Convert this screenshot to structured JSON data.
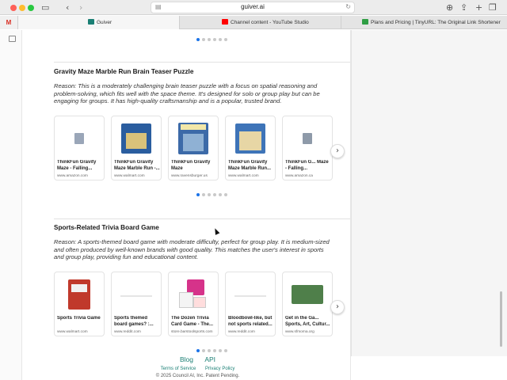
{
  "browser": {
    "url": "guiver.ai",
    "tabs": [
      {
        "label": "Guiver",
        "favicon_color": "#1a7f74",
        "active": true
      },
      {
        "label": "Channel content - YouTube Studio",
        "favicon_color": "#ff0000",
        "active": false
      },
      {
        "label": "Plans and Pricing | TinyURL: The Original Link Shortener",
        "favicon_color": "#2f9e44",
        "active": false
      }
    ],
    "gmail_label": "M"
  },
  "sections": [
    {
      "title": "Gravity Maze Marble Run Brain Teaser Puzzle",
      "reason": "Reason: This is a moderately challenging brain teaser puzzle with a focus on spatial reasoning and problem-solving, which fits well with the space theme. It's designed for solo or group play but can be engaging for groups. It has high-quality craftsmanship and is a popular, trusted brand.",
      "products": [
        {
          "title": "ThinkFun Gravity Maze - Falling...",
          "source": "www.amazon.com",
          "thumb_color": "#9aa6b8"
        },
        {
          "title": "ThinkFun Gravity Maze Marble Run -...",
          "source": "www.walmart.com",
          "thumb_color": "#2a5d9f"
        },
        {
          "title": "ThinkFun Gravity Maze",
          "source": "www.ravensburger.us",
          "thumb_color": "#3c6aa8"
        },
        {
          "title": "ThinkFun Gravity Maze Marble Run...",
          "source": "www.walmart.com",
          "thumb_color": "#3e74b8"
        },
        {
          "title": "ThinkFun G... Maze - Falling...",
          "source": "www.amazon.ca",
          "thumb_color": "#8e9aa9"
        }
      ]
    },
    {
      "title": "Sports-Related Trivia Board Game",
      "reason": "Reason: A sports-themed board game with moderate difficulty, perfect for group play. It is medium-sized and often produced by well-known brands with good quality. This matches the user's interest in sports and group play, providing fun and educational content.",
      "products": [
        {
          "title": "Sports Trivia Game",
          "source": "www.walmart.com",
          "thumb_color": "#c0392b"
        },
        {
          "title": "Sports themed board games? :...",
          "source": "www.reddit.com",
          "thumb_color": ""
        },
        {
          "title": "The Dozen Trivia Card Game - The...",
          "source": "store.barstoolsports.com",
          "thumb_color": "#d6338a"
        },
        {
          "title": "Bloodbowl-like, but not sports related...",
          "source": "www.reddit.com",
          "thumb_color": ""
        },
        {
          "title": "Get in the Ga... Sports, Art, Cultur...",
          "source": "www.sfmoma.org",
          "thumb_color": "#4f7f4a"
        }
      ]
    }
  ],
  "footer": {
    "blog": "Blog",
    "api": "API",
    "terms": "Terms of Service",
    "privacy": "Privacy Policy",
    "copyright": "© 2025 Council AI, Inc. Patent Pending."
  },
  "colors": {
    "accent": "#1a7f74",
    "dot_active": "#1a73e8"
  }
}
